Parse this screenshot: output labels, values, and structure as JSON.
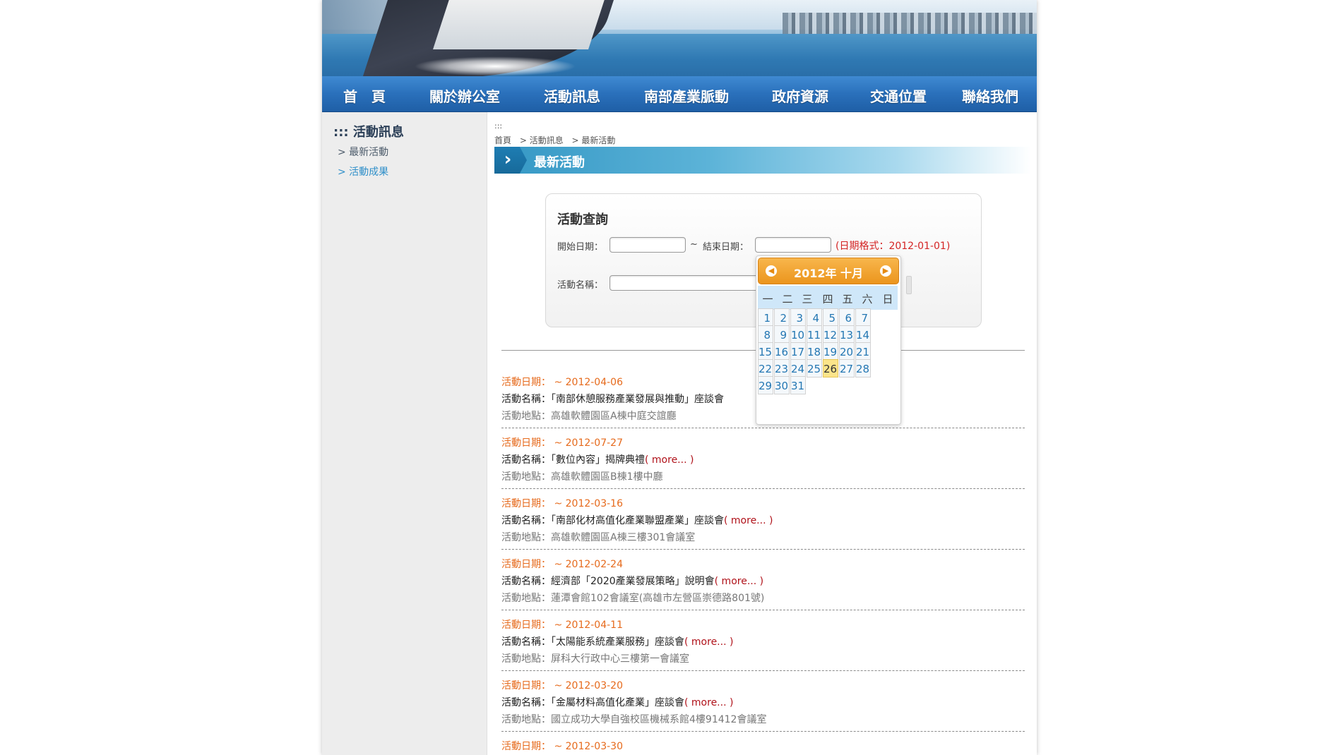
{
  "nav": {
    "items": [
      "首　頁",
      "關於辦公室",
      "活動訊息",
      "南部產業脈動",
      "政府資源",
      "交通位置",
      "聯絡我們"
    ]
  },
  "sidebar": {
    "dots": ":::",
    "title": "活動訊息",
    "links": [
      "> 最新活動",
      "> 活動成果"
    ]
  },
  "breadcrumb": {
    "dots": ":::",
    "items": [
      "首頁",
      "> 活動訊息",
      "> 最新活動"
    ]
  },
  "page_title": "最新活動",
  "search": {
    "title": "活動查詢",
    "start_label": "開始日期：",
    "start_value": "",
    "tilde": "~",
    "end_label": "結束日期：",
    "end_value": "",
    "format_hint": "(日期格式：2012-01-01)",
    "name_label": "活動名稱：",
    "name_value": ""
  },
  "calendar": {
    "month_title": "2012年 十月",
    "prev_icon": "◀",
    "next_icon": "▶",
    "weekdays": [
      "一",
      "二",
      "三",
      "四",
      "五",
      "六",
      "日"
    ],
    "days": [
      "1",
      "2",
      "3",
      "4",
      "5",
      "6",
      "7",
      "8",
      "9",
      "10",
      "11",
      "12",
      "13",
      "14",
      "15",
      "16",
      "17",
      "18",
      "19",
      "20",
      "21",
      "22",
      "23",
      "24",
      "25",
      "26",
      "27",
      "28",
      "29",
      "30",
      "31"
    ],
    "today": "26"
  },
  "events": [
    {
      "date_label": "活動日期：",
      "date": " ~  2012-04-06",
      "name_label": "活動名稱：",
      "name": "「南部休憩服務產業發展與推動」座談會",
      "more": "",
      "loc_label": "活動地點：",
      "loc": "高雄軟體園區A棟中庭交誼廳"
    },
    {
      "date_label": "活動日期：",
      "date": " ~  2012-07-27",
      "name_label": "活動名稱：",
      "name": "「數位內容」揭牌典禮",
      "more": "( more... )",
      "loc_label": "活動地點：",
      "loc": "高雄軟體園區B棟1樓中廳"
    },
    {
      "date_label": "活動日期：",
      "date": " ~  2012-03-16",
      "name_label": "活動名稱：",
      "name": "「南部化材高值化產業聯盟產業」座談會",
      "more": "( more... )",
      "loc_label": "活動地點：",
      "loc": "高雄軟體園區A棟三樓301會議室"
    },
    {
      "date_label": "活動日期：",
      "date": " ~  2012-02-24",
      "name_label": "活動名稱：",
      "name": "經濟部「2020產業發展策略」說明會",
      "more": "( more... )",
      "loc_label": "活動地點：",
      "loc": "蓮潭會館102會議室(高雄市左營區崇德路801號)"
    },
    {
      "date_label": "活動日期：",
      "date": " ~  2012-04-11",
      "name_label": "活動名稱：",
      "name": "「太陽能系統產業服務」座談會",
      "more": "( more... )",
      "loc_label": "活動地點：",
      "loc": "屏科大行政中心三樓第一會議室"
    },
    {
      "date_label": "活動日期：",
      "date": " ~  2012-03-20",
      "name_label": "活動名稱：",
      "name": "「金屬材料高值化產業」座談會",
      "more": "( more... )",
      "loc_label": "活動地點：",
      "loc": "國立成功大學自強校區機械系館4樓91412會議室"
    },
    {
      "date_label": "活動日期：",
      "date": " ~  2012-03-30",
      "name_label": "",
      "name": "",
      "more": "",
      "loc_label": "",
      "loc": ""
    }
  ]
}
